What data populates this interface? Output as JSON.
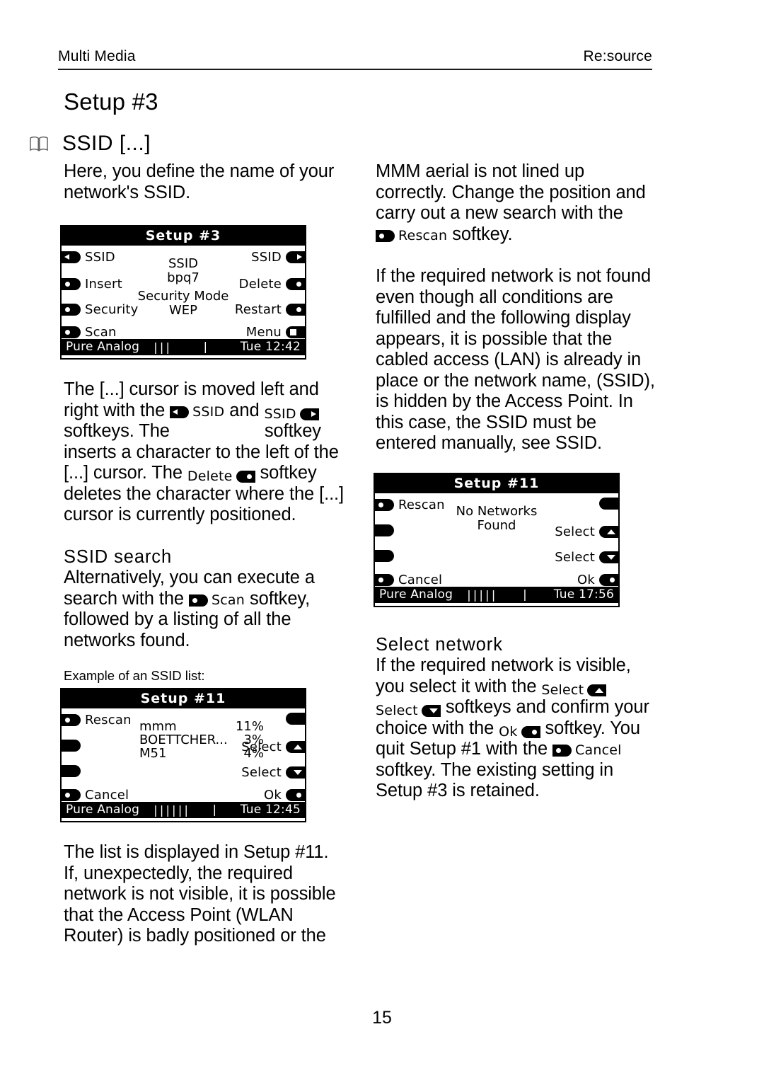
{
  "header": {
    "left": "Multi Media",
    "right": "Re:source"
  },
  "chapter_title": "Setup #3",
  "section": {
    "icon": "book-icon",
    "title": "SSID  [...]"
  },
  "left_column": {
    "intro": "Here, you define the name of your network's SSID.",
    "para_cursor": {
      "t1": "The [...] cursor is moved left and right with the ",
      "key1_label": "SSID",
      "t2": " and ",
      "key2_label": "SSID",
      "t3": " softkeys. The ",
      "t4": " softkey inserts a character to the left of the [...] cursor. The ",
      "key3_label": "Delete",
      "t5": " softkey deletes the character where the [...] cursor is currently positioned."
    },
    "ssid_search_heading": "SSID search",
    "para_search": {
      "t1": "Alternatively, you can execute a search with the ",
      "key_label": "Scan",
      "t2": " softkey, followed by a listing of all the networks found."
    },
    "list_caption": "Example of an SSID list:",
    "para_list": "The list is displayed in Setup #11. If, unexpectedly, the required network is not visible, it is possible that the Access Point (WLAN Router) is badly positioned or the"
  },
  "right_column": {
    "para_aerial": {
      "t1": "MMM aerial is not lined up correctly. Change the position and carry out a new search with the ",
      "key_label": "Rescan",
      "t2": " softkey."
    },
    "para_notfound": "If the required network is not found even though all conditions are fulfilled and the following display appears, it is possible that the cabled access (LAN) is already in place or the network name, (SSID), is hidden by the Access Point. In this case, the SSID must be entered manually, see SSID.",
    "select_network_heading": "Select network",
    "para_select": {
      "t1": "If the required network is visible, you select it with the ",
      "key1_label": "Select",
      "t2": " ",
      "key2_label": "Select",
      "t3": " softkeys and confirm your choice with the ",
      "key3_label": "Ok",
      "t4": " softkey. You quit Setup #1 with the ",
      "key4_label": "Cancel",
      "t5": " softkey. The existing setting in Setup #3 is retained."
    }
  },
  "lcd_setup3": {
    "title": "Setup #3",
    "left_keys": [
      {
        "label": "SSID",
        "glyph": "arrow-left"
      },
      {
        "label": "Insert",
        "glyph": "dot"
      },
      {
        "label": "Security",
        "glyph": "dot"
      },
      {
        "label": "Scan",
        "glyph": "dot"
      }
    ],
    "right_keys": [
      {
        "label": "SSID",
        "glyph": "arrow-right"
      },
      {
        "label": "Delete",
        "glyph": "dot"
      },
      {
        "label": "Restart",
        "glyph": "dot"
      },
      {
        "label": "Menu",
        "glyph": "menu-page"
      }
    ],
    "center_1_label": "SSID",
    "center_1_value": "bpq7",
    "center_2_label": "Security Mode",
    "center_2_value": "WEP",
    "status": {
      "source": "Pure Analog",
      "bars": "|||",
      "tick": "|",
      "clock": "Tue 12:42"
    }
  },
  "lcd_setup11_list": {
    "title": "Setup #11",
    "left_keys": [
      {
        "label": "Rescan",
        "glyph": "dot"
      },
      {
        "label": "",
        "glyph": "blank"
      },
      {
        "label": "",
        "glyph": "blank"
      },
      {
        "label": "Cancel",
        "glyph": "dot"
      }
    ],
    "right_keys": [
      {
        "label": "",
        "glyph": "blank"
      },
      {
        "label": "Select",
        "glyph": "arrow-up"
      },
      {
        "label": "Select",
        "glyph": "arrow-down"
      },
      {
        "label": "Ok",
        "glyph": "dot"
      }
    ],
    "networks": [
      {
        "name": "mmm",
        "strength": "11%"
      },
      {
        "name": "BOETTCHER...",
        "strength": "3%"
      },
      {
        "name": "M51",
        "strength": "4%"
      }
    ],
    "status": {
      "source": "Pure Analog",
      "bars": "||||||",
      "tick": "|",
      "clock": "Tue 12:45"
    }
  },
  "lcd_setup11_empty": {
    "title": "Setup #11",
    "left_keys": [
      {
        "label": "Rescan",
        "glyph": "dot"
      },
      {
        "label": "",
        "glyph": "blank"
      },
      {
        "label": "",
        "glyph": "blank"
      },
      {
        "label": "Cancel",
        "glyph": "dot"
      }
    ],
    "right_keys": [
      {
        "label": "",
        "glyph": "blank"
      },
      {
        "label": "Select",
        "glyph": "arrow-up"
      },
      {
        "label": "Select",
        "glyph": "arrow-down"
      },
      {
        "label": "Ok",
        "glyph": "dot"
      }
    ],
    "center_line_1": "No Networks",
    "center_line_2": "Found",
    "status": {
      "source": "Pure Analog",
      "bars": "|||||",
      "tick": "|",
      "clock": "Tue 17:56"
    }
  },
  "page_number": "15"
}
